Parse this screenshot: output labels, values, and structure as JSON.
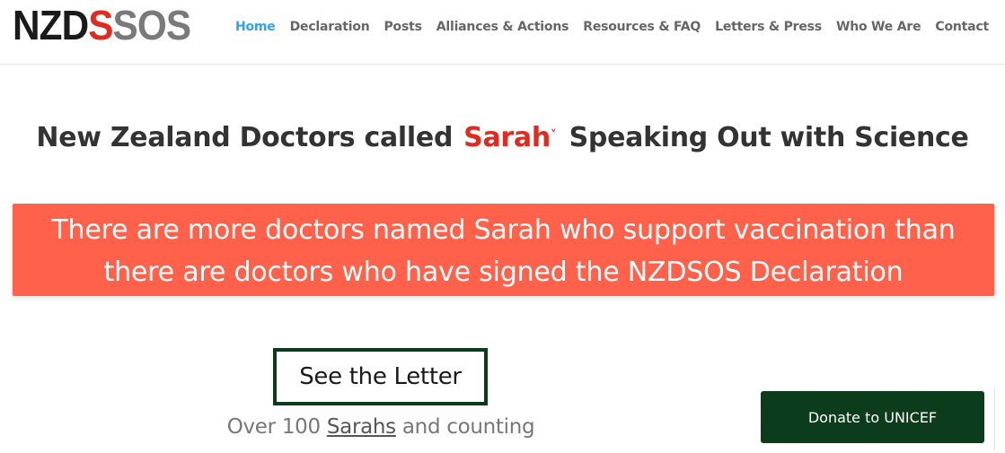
{
  "logo": {
    "part1": "NZD",
    "part2": "S",
    "part3": "SOS"
  },
  "nav": {
    "items": [
      "Home",
      "Declaration",
      "Posts",
      "Alliances & Actions",
      "Resources & FAQ",
      "Letters & Press",
      "Who We Are",
      "Contact"
    ],
    "active": "Home"
  },
  "headline": {
    "before": "New Zealand Doctors called",
    "name": "Sarah",
    "chevron": "˅",
    "after": "Speaking Out with Science"
  },
  "banner": {
    "line1": "There are more doctors named Sarah who support vaccination than",
    "line2": "there are doctors who have signed the NZDSOS Declaration"
  },
  "letter_button": "See the Letter",
  "counting": {
    "before": "Over 100 ",
    "link": "Sarahs",
    "after": " and counting"
  },
  "donate_button": "Donate to UNICEF",
  "colors": {
    "accent_red": "#e02b20",
    "banner": "#ff614b",
    "dark_green": "#0b3d1c",
    "nav_active": "#2ea3f2"
  }
}
